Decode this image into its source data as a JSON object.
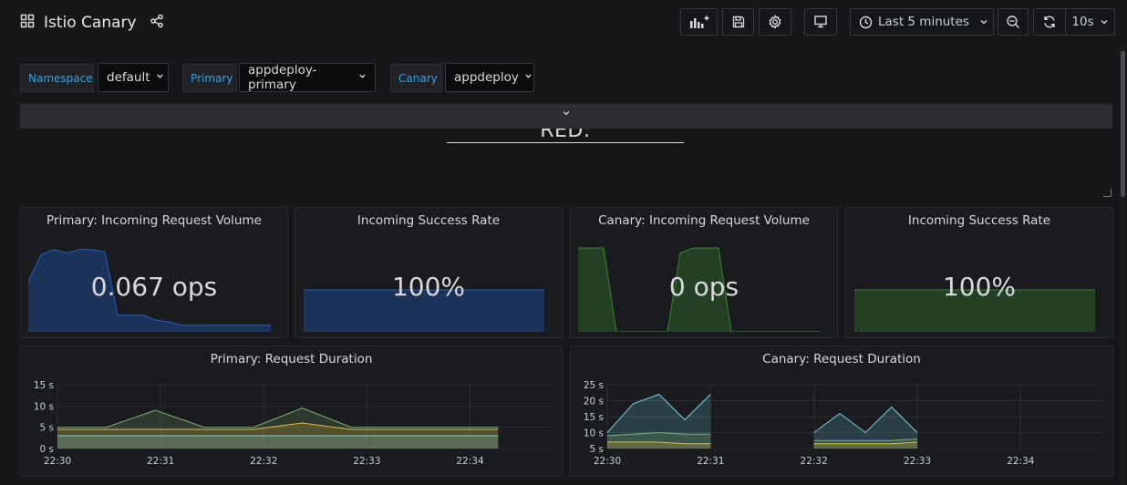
{
  "header": {
    "title": "Istio Canary",
    "time_range": "Last 5 minutes",
    "refresh_interval": "10s"
  },
  "variables": [
    {
      "label": "Namespace",
      "value": "default"
    },
    {
      "label": "Primary",
      "value": "appdeploy-primary"
    },
    {
      "label": "Canary",
      "value": "appdeploy"
    }
  ],
  "row": {
    "text": "RED: appdeploy.default"
  },
  "stats": [
    {
      "title": "Primary: Incoming Request Volume",
      "value": "0.067 ops",
      "color": "#1f60c4",
      "spark": [
        0.6,
        0.92,
        0.98,
        0.94,
        0.98,
        0.98,
        0.95,
        0.2,
        0.2,
        0.2,
        0.14,
        0.12,
        0.08,
        0.08,
        0.08,
        0.08,
        0.08,
        0.08,
        0.08,
        0.08
      ]
    },
    {
      "title": "Incoming Success Rate",
      "value": "100%",
      "color": "#1f60c4",
      "spark": [
        0.5,
        0.5,
        0.5,
        0.5,
        0.5,
        0.5,
        0.5,
        0.5,
        0.5,
        0.5
      ]
    },
    {
      "title": "Canary: Incoming Request Volume",
      "value": "0 ops",
      "color": "#37872d",
      "spark": [
        1,
        1,
        1,
        0,
        0,
        0,
        0,
        0,
        0.94,
        1,
        1,
        1,
        0,
        0,
        0,
        0,
        0,
        0,
        0,
        0
      ]
    },
    {
      "title": "Incoming Success Rate",
      "value": "100%",
      "color": "#37872d",
      "spark": [
        0.5,
        0.5,
        0.5,
        0.5,
        0.5,
        0.5,
        0.5,
        0.5,
        0.5,
        0.5
      ]
    }
  ],
  "chart_data": [
    {
      "type": "area",
      "title": "Primary: Request Duration",
      "x": [
        "22:30",
        "22:30:30",
        "22:31",
        "22:31:30",
        "22:32",
        "22:32:30",
        "22:33",
        "22:33:30",
        "22:34",
        "22:34:30"
      ],
      "xticks": [
        "22:30",
        "22:31",
        "22:32",
        "22:33",
        "22:34"
      ],
      "yticks": [
        "0 s",
        "5 s",
        "10 s",
        "15 s"
      ],
      "ylim": [
        0,
        15
      ],
      "series": [
        {
          "color": "#7eb26d",
          "values": [
            5,
            5,
            9,
            5,
            5,
            9.5,
            5,
            5,
            5,
            5
          ]
        },
        {
          "color": "#eab839",
          "values": [
            4.5,
            4.5,
            4.5,
            4.5,
            4.5,
            6,
            4.5,
            4.5,
            4.5,
            4.5
          ]
        },
        {
          "color": "#6ed0e0",
          "values": [
            3,
            3,
            3,
            3,
            3,
            3,
            3,
            3,
            3,
            3
          ]
        }
      ]
    },
    {
      "type": "area",
      "title": "Canary: Request Duration",
      "x": [
        "22:30",
        "22:30:15",
        "22:30:30",
        "22:30:45",
        "22:31",
        "22:32",
        "22:32:15",
        "22:32:30",
        "22:32:45",
        "22:33"
      ],
      "xticks": [
        "22:30",
        "22:31",
        "22:32",
        "22:33",
        "22:34"
      ],
      "yticks": [
        "5 s",
        "10 s",
        "15 s",
        "20 s",
        "25 s"
      ],
      "ylim": [
        5,
        25
      ],
      "series": [
        {
          "color": "#6ed0e0",
          "values": [
            10,
            19,
            22,
            14,
            22,
            10,
            16,
            10,
            18,
            10
          ]
        },
        {
          "color": "#7eb26d",
          "values": [
            9,
            9.5,
            10,
            9.5,
            9.5,
            7.5,
            7.5,
            7.5,
            7.5,
            8
          ]
        },
        {
          "color": "#eab839",
          "values": [
            7,
            7,
            7,
            6.5,
            6.5,
            6.5,
            6.5,
            6.5,
            6.5,
            7
          ]
        }
      ]
    }
  ]
}
